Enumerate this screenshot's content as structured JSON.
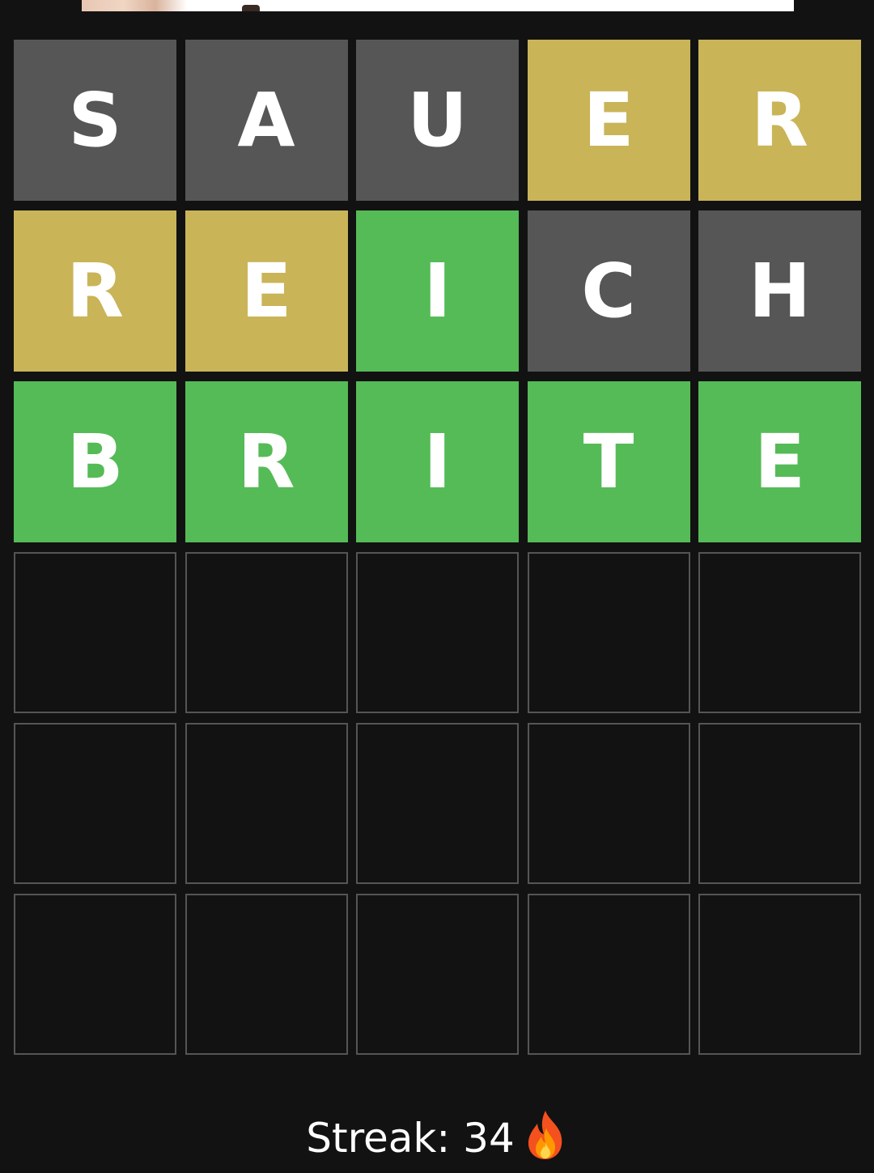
{
  "colors": {
    "background": "#121212",
    "absent": "#565656",
    "present": "#c9b458",
    "correct": "#55bb57",
    "empty_border": "#555555",
    "text": "#ffffff"
  },
  "board": {
    "rows": [
      [
        {
          "letter": "S",
          "state": "absent"
        },
        {
          "letter": "A",
          "state": "absent"
        },
        {
          "letter": "U",
          "state": "absent"
        },
        {
          "letter": "E",
          "state": "present"
        },
        {
          "letter": "R",
          "state": "present"
        }
      ],
      [
        {
          "letter": "R",
          "state": "present"
        },
        {
          "letter": "E",
          "state": "present"
        },
        {
          "letter": "I",
          "state": "correct"
        },
        {
          "letter": "C",
          "state": "absent"
        },
        {
          "letter": "H",
          "state": "absent"
        }
      ],
      [
        {
          "letter": "B",
          "state": "correct"
        },
        {
          "letter": "R",
          "state": "correct"
        },
        {
          "letter": "I",
          "state": "correct"
        },
        {
          "letter": "T",
          "state": "correct"
        },
        {
          "letter": "E",
          "state": "correct"
        }
      ],
      [
        {
          "letter": "",
          "state": "empty"
        },
        {
          "letter": "",
          "state": "empty"
        },
        {
          "letter": "",
          "state": "empty"
        },
        {
          "letter": "",
          "state": "empty"
        },
        {
          "letter": "",
          "state": "empty"
        }
      ],
      [
        {
          "letter": "",
          "state": "empty"
        },
        {
          "letter": "",
          "state": "empty"
        },
        {
          "letter": "",
          "state": "empty"
        },
        {
          "letter": "",
          "state": "empty"
        },
        {
          "letter": "",
          "state": "empty"
        }
      ],
      [
        {
          "letter": "",
          "state": "empty"
        },
        {
          "letter": "",
          "state": "empty"
        },
        {
          "letter": "",
          "state": "empty"
        },
        {
          "letter": "",
          "state": "empty"
        },
        {
          "letter": "",
          "state": "empty"
        }
      ]
    ]
  },
  "streak": {
    "label": "Streak: 34",
    "icon": "fire-icon"
  }
}
